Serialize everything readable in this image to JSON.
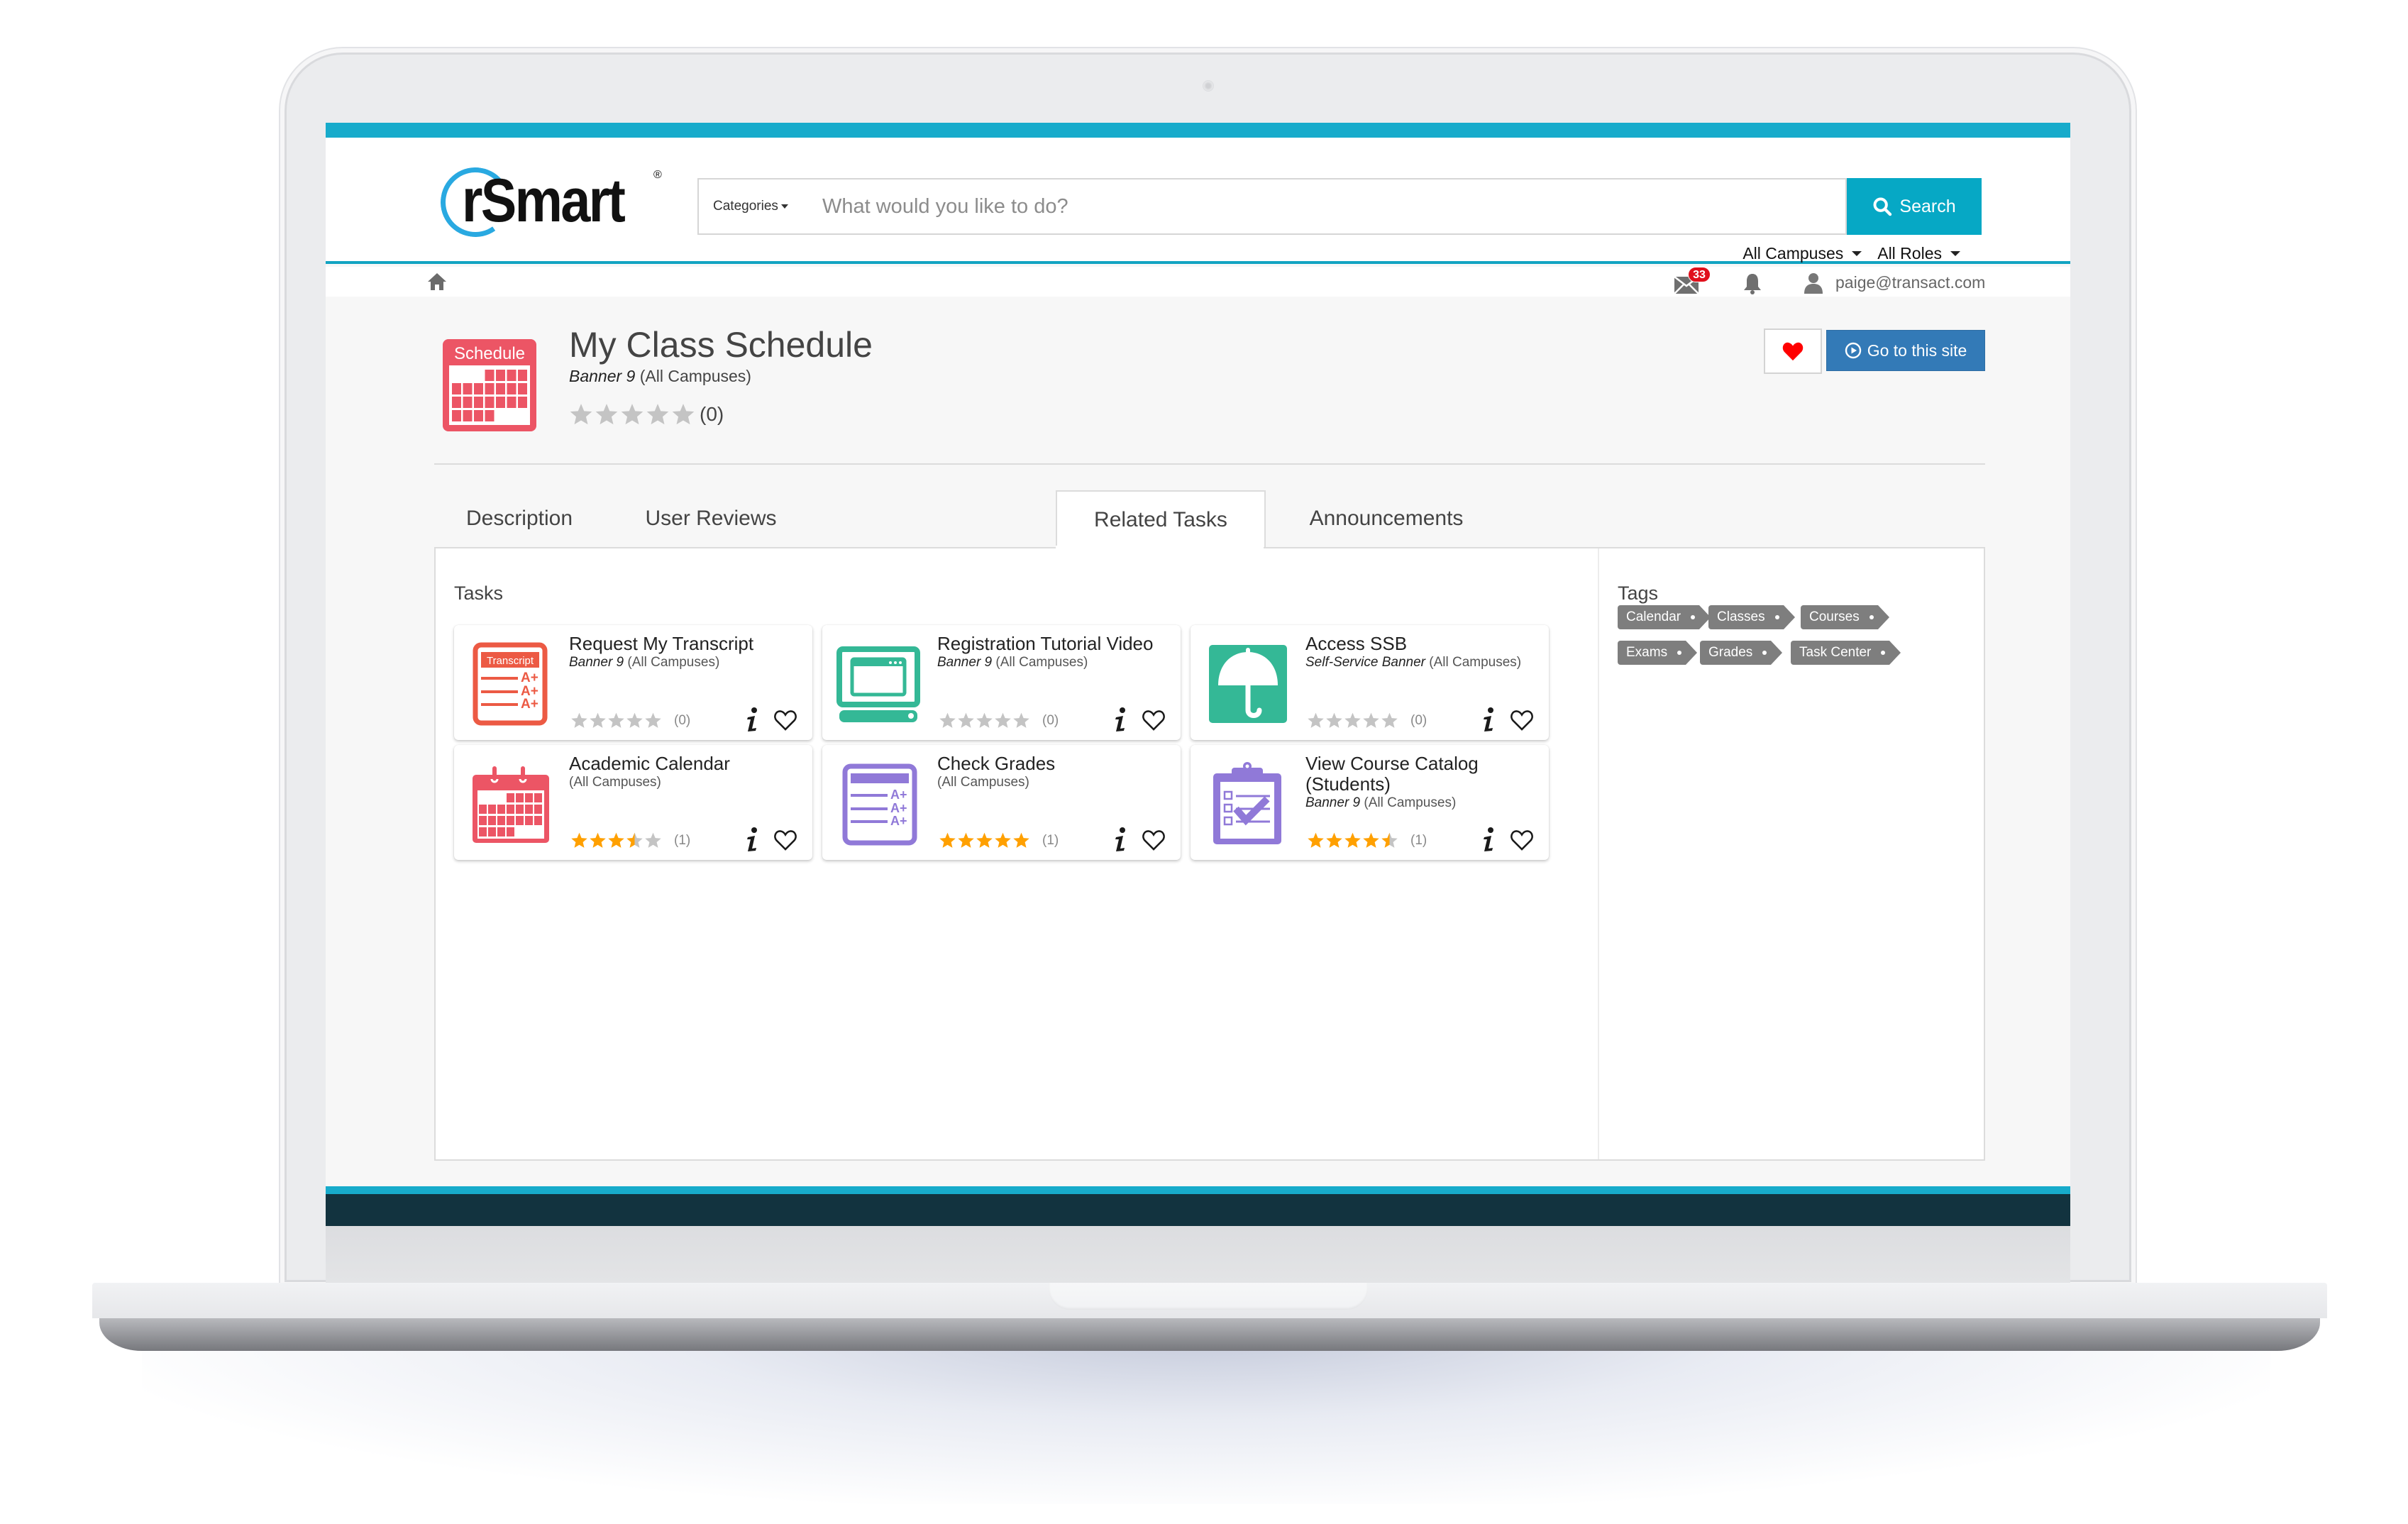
{
  "colors": {
    "brand_teal": "#17abcb",
    "search_button": "#06a8c5",
    "go_button": "#337ab7",
    "footer_dark": "#12333f",
    "star_filled": "#ffa000",
    "star_empty": "#c4c4c4",
    "schedule_red": "#ec5565",
    "transcript_orange": "#ec5a44",
    "green": "#34b896",
    "purple": "#9079d8",
    "tag_gray": "#7e7e7e",
    "heart_red": "#ff0000"
  },
  "header": {
    "logo_text": "rSmart",
    "logo_mark": "®",
    "search": {
      "categories_label": "Categories",
      "placeholder": "What would you like to do?",
      "value": "",
      "button_label": "Search",
      "button_icon": "search-icon"
    },
    "filters": {
      "campus": "All Campuses",
      "role": "All Roles"
    }
  },
  "nav": {
    "home_icon": "home-icon",
    "mail_icon": "envelope-icon",
    "mail_badge": "33",
    "bell_icon": "bell-icon",
    "user_icon": "user-icon",
    "user_email": "paige@transact.com"
  },
  "app": {
    "icon_label": "Schedule",
    "title": "My Class Schedule",
    "source": "Banner 9",
    "scope": "(All Campuses)",
    "rating": 0,
    "rating_max": 5,
    "rating_count": "(0)",
    "favorite_icon": "heart-icon",
    "go_button_label": "Go to this site",
    "go_button_icon": "play-circle-icon"
  },
  "tabs": [
    {
      "label": "Description",
      "active": false
    },
    {
      "label": "User Reviews",
      "active": false
    },
    {
      "label": "Related Tasks",
      "active": true
    },
    {
      "label": "Announcements",
      "active": false
    }
  ],
  "tasks_section": {
    "title": "Tasks",
    "items": [
      {
        "name": "Request My Transcript",
        "source": "Banner 9",
        "scope": "(All Campuses)",
        "rating": 0,
        "count": "(0)",
        "icon": "transcript-icon",
        "icon_label": "Transcript",
        "favorited": false
      },
      {
        "name": "Registration Tutorial Video",
        "source": "Banner 9",
        "scope": "(All Campuses)",
        "rating": 0,
        "count": "(0)",
        "icon": "computer-window-icon",
        "favorited": false
      },
      {
        "name": "Access SSB",
        "source": "Self-Service Banner",
        "scope": "(All Campuses)",
        "rating": 0,
        "count": "(0)",
        "icon": "umbrella-icon",
        "favorited": false
      },
      {
        "name": "Academic Calendar",
        "source": "",
        "scope": "(All Campuses)",
        "rating": 3.5,
        "count": "(1)",
        "icon": "calendar-icon",
        "favorited": false
      },
      {
        "name": "Check Grades",
        "source": "",
        "scope": "(All Campuses)",
        "rating": 5,
        "count": "(1)",
        "icon": "grades-sheet-icon",
        "favorited": false
      },
      {
        "name": "View Course Catalog (Students)",
        "source": "Banner 9",
        "scope": "(All Campuses)",
        "rating": 4.5,
        "count": "(1)",
        "icon": "clipboard-check-icon",
        "favorited": false
      }
    ]
  },
  "tags_section": {
    "title": "Tags",
    "items": [
      "Calendar",
      "Classes",
      "Courses",
      "Exams",
      "Grades",
      "Task Center"
    ]
  }
}
